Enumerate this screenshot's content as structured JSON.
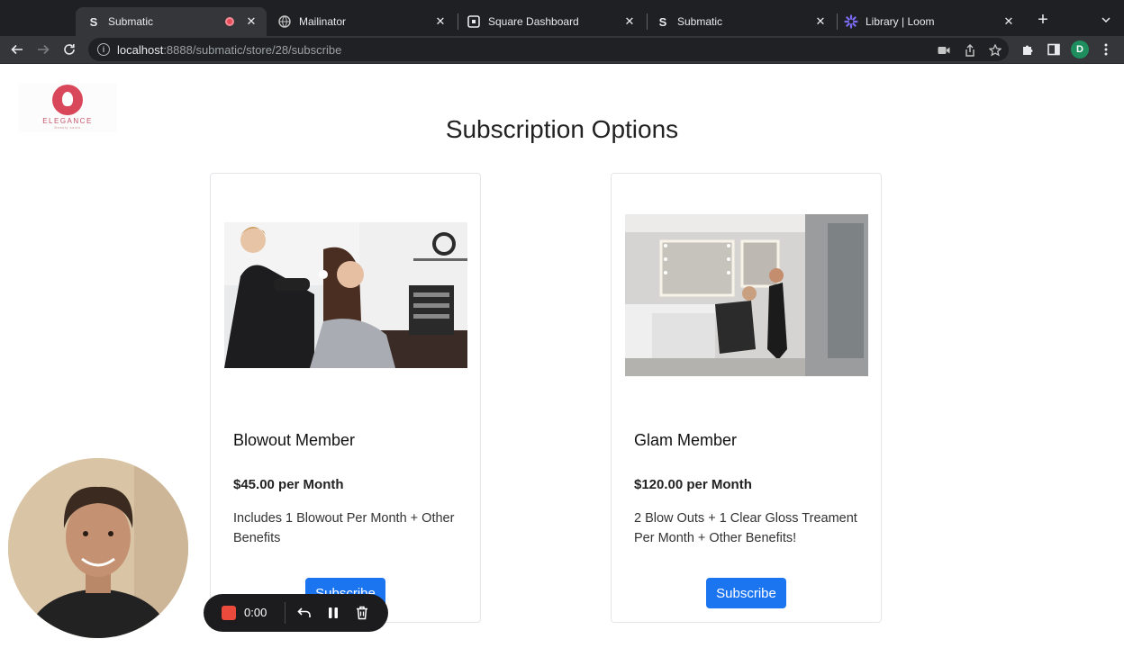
{
  "browser": {
    "tabs": [
      {
        "title": "Submatic",
        "favicon": "S",
        "active": true,
        "recording": true
      },
      {
        "title": "Mailinator",
        "favicon": "globe-icon",
        "active": false
      },
      {
        "title": "Square Dashboard",
        "favicon": "square-icon",
        "active": false
      },
      {
        "title": "Submatic",
        "favicon": "S",
        "active": false
      },
      {
        "title": "Library | Loom",
        "favicon": "loom-icon",
        "active": false
      }
    ],
    "url_host": "localhost",
    "url_path": ":8888/submatic/store/28/subscribe",
    "profile_initial": "D"
  },
  "page": {
    "logo_text": "ELEGANCE",
    "logo_subtext": "Beauty salon",
    "title": "Subscription Options",
    "plans": [
      {
        "name": "Blowout Member",
        "price": "$45.00 per Month",
        "description": "Includes 1 Blowout Per Month + Other Benefits",
        "button": "Subscribe"
      },
      {
        "name": "Glam Member",
        "price": "$120.00 per Month",
        "description": "2 Blow Outs + 1 Clear Gloss Treament Per Month + Other Benefits!",
        "button": "Subscribe"
      }
    ]
  },
  "recorder": {
    "time": "0:00",
    "stop_color": "#ea4a3c"
  },
  "colors": {
    "accent": "#1b74f0",
    "logo": "#d9475b"
  }
}
